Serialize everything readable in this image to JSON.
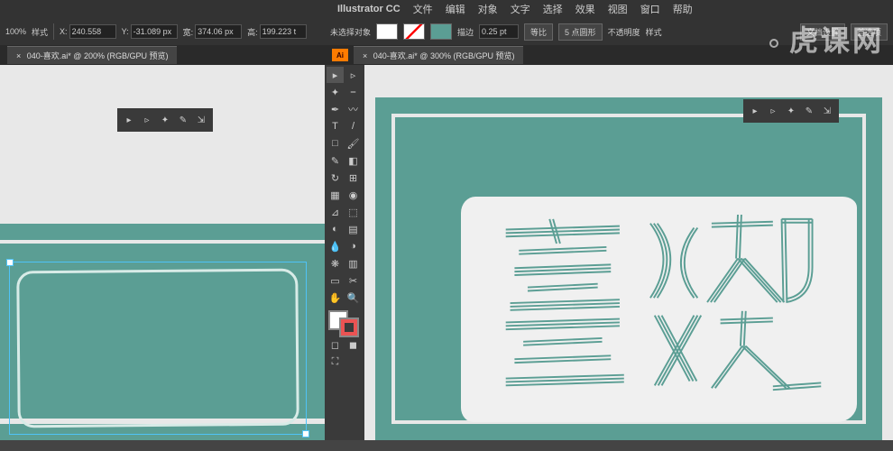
{
  "menubar": {
    "app": "Illustrator CC",
    "items": [
      "文件",
      "编辑",
      "对象",
      "文字",
      "选择",
      "效果",
      "视图",
      "窗口",
      "帮助"
    ]
  },
  "optbar_left": {
    "zoom": "100%",
    "style_label": "样式",
    "x_label": "X:",
    "x_val": "240.558",
    "y_label": "Y:",
    "y_val": "-31.089 px",
    "w_label": "宽:",
    "w_val": "374.06 px",
    "h_label": "高:",
    "h_val": "199.223 t"
  },
  "tab_left": {
    "label": "040-喜欢.ai* @ 200% (RGB/GPU 预览)"
  },
  "optbar_right": {
    "no_sel": "未选择对象",
    "stroke_label": "描边",
    "stroke_val": "0.25 pt",
    "uniform": "等比",
    "basic": "5 点圆形",
    "opacity_label": "不透明度",
    "style": "样式",
    "doc_setup": "文档设置",
    "prefs": "首选项"
  },
  "tab_right": {
    "label": "040-喜欢.ai* @ 300% (RGB/GPU 预览)"
  },
  "float_toolbar": {
    "icons": [
      "select",
      "direct",
      "anchor",
      "pen",
      "handle"
    ]
  },
  "tools": [
    "▸",
    "▹",
    "✦",
    "⎯",
    "T",
    "/",
    "□",
    "◢",
    "✎",
    "✂",
    "↻",
    "⊞",
    "▦",
    "◉",
    "⊿",
    "⬚",
    "◐",
    "⚙",
    "✋",
    "🔍",
    "▭",
    "▤"
  ],
  "watermark": "虎课网"
}
